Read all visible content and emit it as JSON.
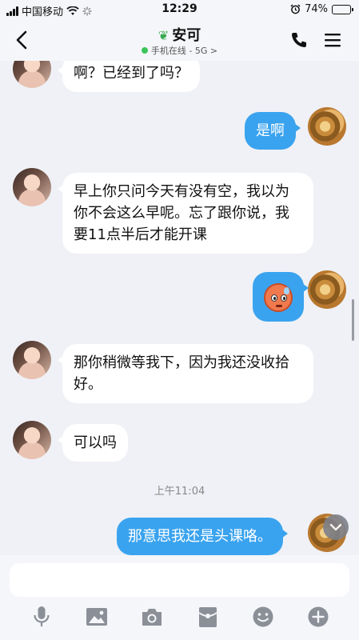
{
  "status_bar": {
    "carrier": "中国移动",
    "time": "12:29",
    "battery_percent": "74%",
    "battery_level": 0.74
  },
  "header": {
    "contact_name": "安可",
    "online_status": "手机在线 - 5G",
    "status_arrow": ">"
  },
  "messages": [
    {
      "side": "left",
      "text": "啊？已经到了吗？"
    },
    {
      "side": "right",
      "text": "是啊"
    },
    {
      "side": "left",
      "text": "早上你只问今天有没有空，我以为你不会这么早呢。忘了跟你说，我要11点半后才能开课"
    },
    {
      "side": "right",
      "type": "emoji",
      "emoji": "sweat-face-emoji"
    },
    {
      "side": "left",
      "text": "那你稍微等我下，因为我还没收拾好。"
    },
    {
      "side": "left",
      "text": "可以吗"
    },
    {
      "side": "right",
      "text": "那意思我还是头课咯。"
    }
  ],
  "timestamp": "上午11:04",
  "input": {
    "placeholder": ""
  },
  "toolbar": [
    "microphone-icon",
    "image-icon",
    "camera-icon",
    "red-packet-icon",
    "emoji-icon",
    "plus-icon"
  ],
  "colors": {
    "bubble_sent": "#3aa3ef",
    "bubble_received": "#ffffff",
    "background": "#eff1f6"
  }
}
